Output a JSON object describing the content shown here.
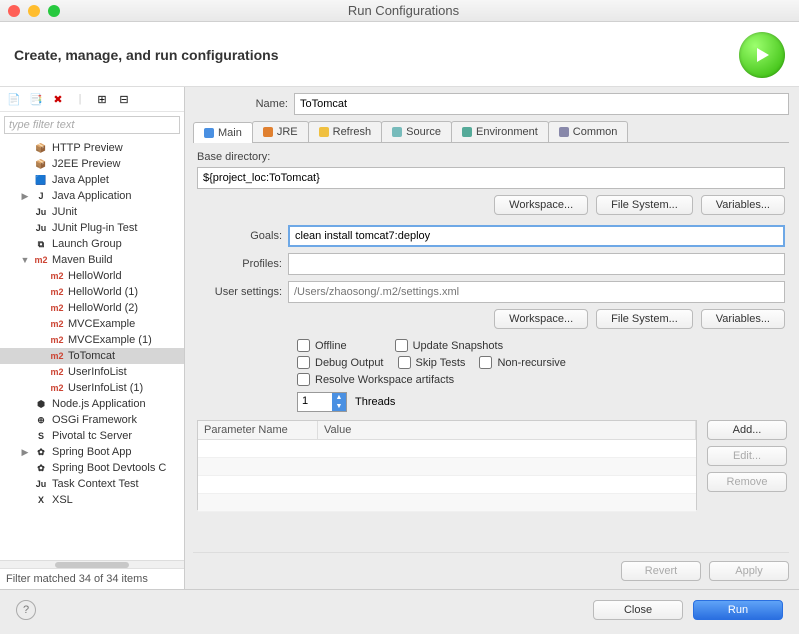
{
  "window": {
    "title": "Run Configurations"
  },
  "header": {
    "subtitle": "Create, manage, and run configurations"
  },
  "filter": {
    "placeholder": "type filter text"
  },
  "tree": [
    {
      "label": "HTTP Preview",
      "icon": "http",
      "indent": 1
    },
    {
      "label": "J2EE Preview",
      "icon": "j2ee",
      "indent": 1
    },
    {
      "label": "Java Applet",
      "icon": "applet",
      "indent": 1
    },
    {
      "label": "Java Application",
      "icon": "javaapp",
      "indent": 1,
      "arrow": "▶"
    },
    {
      "label": "JUnit",
      "icon": "junit",
      "indent": 1
    },
    {
      "label": "JUnit Plug-in Test",
      "icon": "junit",
      "indent": 1
    },
    {
      "label": "Launch Group",
      "icon": "group",
      "indent": 1
    },
    {
      "label": "Maven Build",
      "icon": "m2",
      "indent": 1,
      "arrow": "▼"
    },
    {
      "label": "HelloWorld",
      "icon": "m2",
      "indent": 2
    },
    {
      "label": "HelloWorld (1)",
      "icon": "m2",
      "indent": 2
    },
    {
      "label": "HelloWorld (2)",
      "icon": "m2",
      "indent": 2
    },
    {
      "label": "MVCExample",
      "icon": "m2",
      "indent": 2
    },
    {
      "label": "MVCExample (1)",
      "icon": "m2",
      "indent": 2
    },
    {
      "label": "ToTomcat",
      "icon": "m2",
      "indent": 2,
      "selected": true
    },
    {
      "label": "UserInfoList",
      "icon": "m2",
      "indent": 2
    },
    {
      "label": "UserInfoList (1)",
      "icon": "m2",
      "indent": 2
    },
    {
      "label": "Node.js Application",
      "icon": "node",
      "indent": 1
    },
    {
      "label": "OSGi Framework",
      "icon": "osgi",
      "indent": 1
    },
    {
      "label": "Pivotal tc Server",
      "icon": "pivotal",
      "indent": 1
    },
    {
      "label": "Spring Boot App",
      "icon": "spring",
      "indent": 1,
      "arrow": "▶"
    },
    {
      "label": "Spring Boot Devtools C",
      "icon": "spring",
      "indent": 1
    },
    {
      "label": "Task Context Test",
      "icon": "task",
      "indent": 1
    },
    {
      "label": "XSL",
      "icon": "xsl",
      "indent": 1
    }
  ],
  "status": "Filter matched 34 of 34 items",
  "form": {
    "name_label": "Name:",
    "name_value": "ToTomcat",
    "basedir_label": "Base directory:",
    "basedir_value": "${project_loc:ToTomcat}",
    "goals_label": "Goals:",
    "goals_value": "clean install tomcat7:deploy",
    "profiles_label": "Profiles:",
    "profiles_value": "",
    "usersettings_label": "User settings:",
    "usersettings_placeholder": "/Users/zhaosong/.m2/settings.xml"
  },
  "tabs": [
    "Main",
    "JRE",
    "Refresh",
    "Source",
    "Environment",
    "Common"
  ],
  "buttons": {
    "workspace": "Workspace...",
    "filesystem": "File System...",
    "variables": "Variables...",
    "add": "Add...",
    "edit": "Edit...",
    "remove": "Remove",
    "revert": "Revert",
    "apply": "Apply",
    "close": "Close",
    "run": "Run"
  },
  "checks": {
    "offline": "Offline",
    "update": "Update Snapshots",
    "debug": "Debug Output",
    "skip": "Skip Tests",
    "nonrec": "Non-recursive",
    "resolve": "Resolve Workspace artifacts"
  },
  "threads": {
    "value": "1",
    "label": "Threads"
  },
  "table": {
    "col1": "Parameter Name",
    "col2": "Value"
  }
}
